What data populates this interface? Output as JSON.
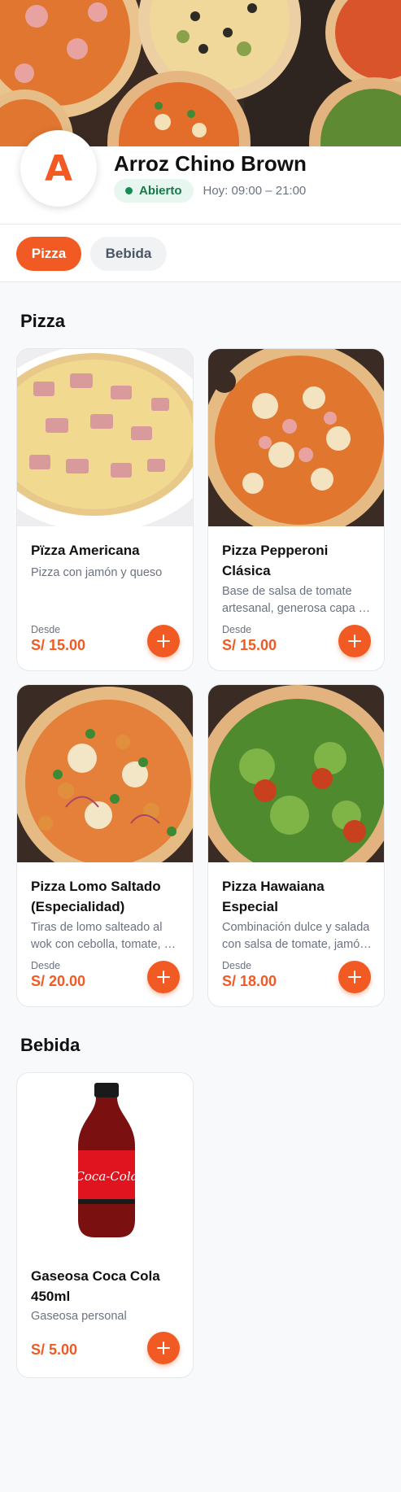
{
  "store": {
    "avatar_letter": "A",
    "name": "Arroz Chino Brown",
    "status": "Abierto",
    "hours": "Hoy: 09:00 – 21:00"
  },
  "tabs": [
    {
      "label": "Pizza",
      "active": true
    },
    {
      "label": "Bebida",
      "active": false
    }
  ],
  "sections": [
    {
      "title": "Pizza",
      "items": [
        {
          "name": "Pïzza Americana",
          "description": "Pizza con jamón y queso",
          "from_label": "Desde",
          "price": "S/ 15.00",
          "image": "pizza-ham-cheese"
        },
        {
          "name": "Pizza Pepperoni Clásica",
          "description": "Base de salsa de tomate artesanal, generosa capa de queso mozzarella y pepperoni",
          "from_label": "Desde",
          "price": "S/ 15.00",
          "image": "pizza-pepperoni"
        },
        {
          "name": "Pizza Lomo Saltado (Especialidad)",
          "description": "Tiras de lomo salteado al wok con cebolla, tomate, ají amarillo y sillao",
          "from_label": "Desde",
          "price": "S/ 20.00",
          "image": "pizza-lomo"
        },
        {
          "name": "Pizza Hawaiana Especial",
          "description": "Combinación dulce y salada con salsa de tomate, jamón y piña",
          "from_label": "Desde",
          "price": "S/ 18.00",
          "image": "pizza-hawaiana"
        }
      ]
    },
    {
      "title": "Bebida",
      "items": [
        {
          "name": "Gaseosa Coca Cola 450ml",
          "description": "Gaseosa personal",
          "price": "S/ 5.00",
          "image": "coca-cola-bottle"
        }
      ]
    }
  ],
  "colors": {
    "accent": "#f15a22",
    "open_badge_bg": "#e7f6ee",
    "open_badge_text": "#16794a"
  },
  "icons": {
    "add": "plus-icon",
    "status": "status-dot-icon"
  }
}
